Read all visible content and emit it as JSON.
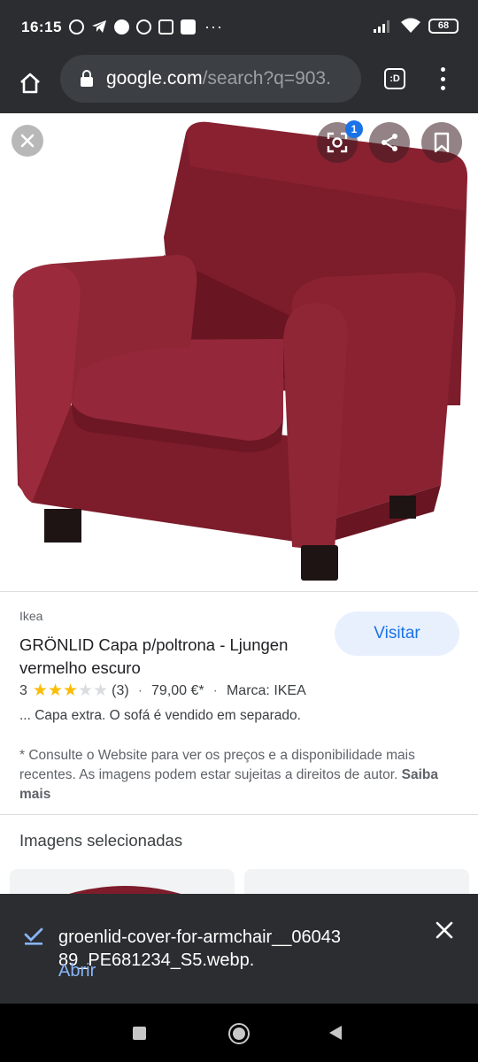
{
  "status_bar": {
    "time": "16:15",
    "battery": "68",
    "notification_icons": [
      "pinterest-icon",
      "telegram-icon",
      "facebook-icon",
      "whatsapp-icon",
      "outlook-icon",
      "gmail-icon"
    ],
    "more": "···"
  },
  "browser": {
    "url_domain": "google.com",
    "url_path": "/search?q=903.",
    "tabs_label": ":D"
  },
  "viewer": {
    "lens_badge": "1",
    "colors": {
      "chair_red": "#8b2130",
      "chair_dark": "#6e1724",
      "legs": "#1e1414"
    }
  },
  "result": {
    "source": "Ikea",
    "title": "GRÖNLID Capa p/poltrona - Ljungen vermelho escuro",
    "visit_label": "Visitar",
    "rating_value": "3",
    "rating": 3,
    "rating_max": 5,
    "review_count": "(3)",
    "price": "79,00 €*",
    "brand": "Marca: IKEA",
    "snippet": "... Capa extra. O sofá é vendido em separado.",
    "disclaimer": "* Consulte o Website para ver os preços e a disponibilidade mais recentes. As imagens podem estar sujeitas a direitos de autor.",
    "learn_more": "Saiba mais"
  },
  "related": {
    "title": "Imagens selecionadas"
  },
  "download": {
    "filename": "groenlid-cover-for-armchair__0604389_PE681234_S5.webp.",
    "open_label": "Abrir"
  },
  "colors": {
    "accent_blue": "#1a73e8",
    "link_blue": "#8ab4f8",
    "dark_bar": "#2b2d30",
    "star": "#fbbc04"
  }
}
